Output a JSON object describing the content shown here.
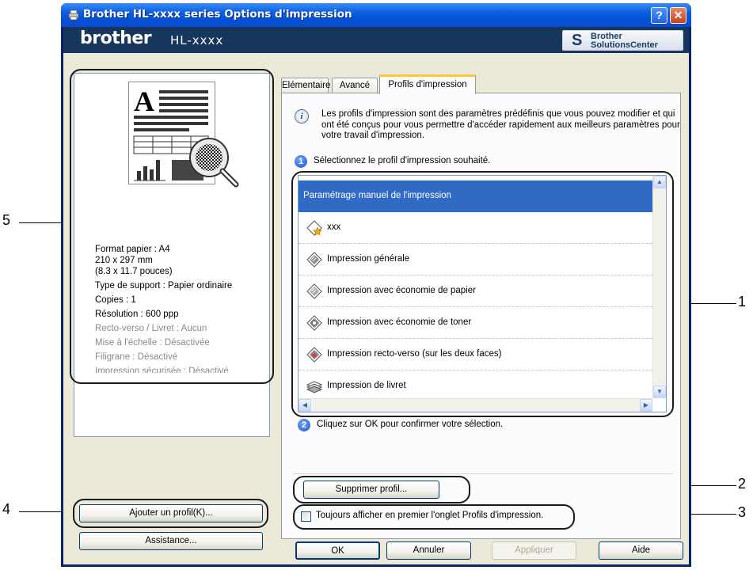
{
  "window": {
    "title": "Brother HL-xxxx series Options d'impression",
    "help_button": "?",
    "close_button": "✕"
  },
  "brand_bar": {
    "logo": "brother",
    "model": "HL-xxxx",
    "solutions_line1": "Brother",
    "solutions_line2": "SolutionsCenter"
  },
  "preview": {
    "paper_size": "Format papier : A4",
    "dimensions_mm": "210 x 297 mm",
    "dimensions_in": "(8.3 x 11.7 pouces)",
    "media_type": "Type de support : Papier ordinaire",
    "copies": "Copies : 1",
    "resolution": "Résolution : 600 ppp",
    "duplex": "Recto-verso / Livret : Aucun",
    "scaling": "Mise à l'échelle : Désactivée",
    "watermark": "Filigrane : Désactivé",
    "secure_print": "Impression sécurisée : Désactivé"
  },
  "left_buttons": {
    "add_profile": "Ajouter un profil(K)...",
    "support": "Assistance..."
  },
  "tabs": [
    {
      "label": "Elémentaire"
    },
    {
      "label": "Avancé"
    },
    {
      "label": "Profils d'impression",
      "active": true
    }
  ],
  "tab_content": {
    "info_text": "Les profils d'impression sont des paramètres prédéfinis que vous pouvez modifier et qui ont été conçus pour vous permettre d'accéder rapidement aux meilleurs paramètres pour votre travail d'impression.",
    "step1_number": "1",
    "step1_text": "Sélectionnez le profil d'impression souhaité.",
    "profiles": [
      {
        "label": "Paramétrage manuel de l'impression",
        "icon": "none",
        "selected": true
      },
      {
        "label": "xxx",
        "icon": "custom-profile-star-icon"
      },
      {
        "label": "Impression générale",
        "icon": "general-print-icon"
      },
      {
        "label": "Impression avec économie de papier",
        "icon": "paper-save-icon"
      },
      {
        "label": "Impression avec économie de toner",
        "icon": "toner-save-icon"
      },
      {
        "label": "Impression recto-verso (sur les deux faces)",
        "icon": "duplex-print-icon"
      },
      {
        "label": "Impression de livret",
        "icon": "booklet-print-icon"
      }
    ],
    "step2_number": "2",
    "step2_text": "Cliquez sur OK pour confirmer votre sélection.",
    "delete_profile": "Supprimer profil...",
    "always_show_label": "Toujours afficher en premier l'onglet Profils d'impression.",
    "always_show_checked": false
  },
  "bottom_buttons": {
    "ok": "OK",
    "cancel": "Annuler",
    "apply": "Appliquer",
    "help": "Aide"
  },
  "callouts": {
    "c1": "1",
    "c2": "2",
    "c3": "3",
    "c4": "4",
    "c5": "5"
  },
  "colors": {
    "titlebar": "#0a5ce0",
    "brand_bar": "#16365e",
    "selection": "#316ac5",
    "dialog_face": "#ece9d8",
    "active_tab_accent": "#ffc83c"
  }
}
